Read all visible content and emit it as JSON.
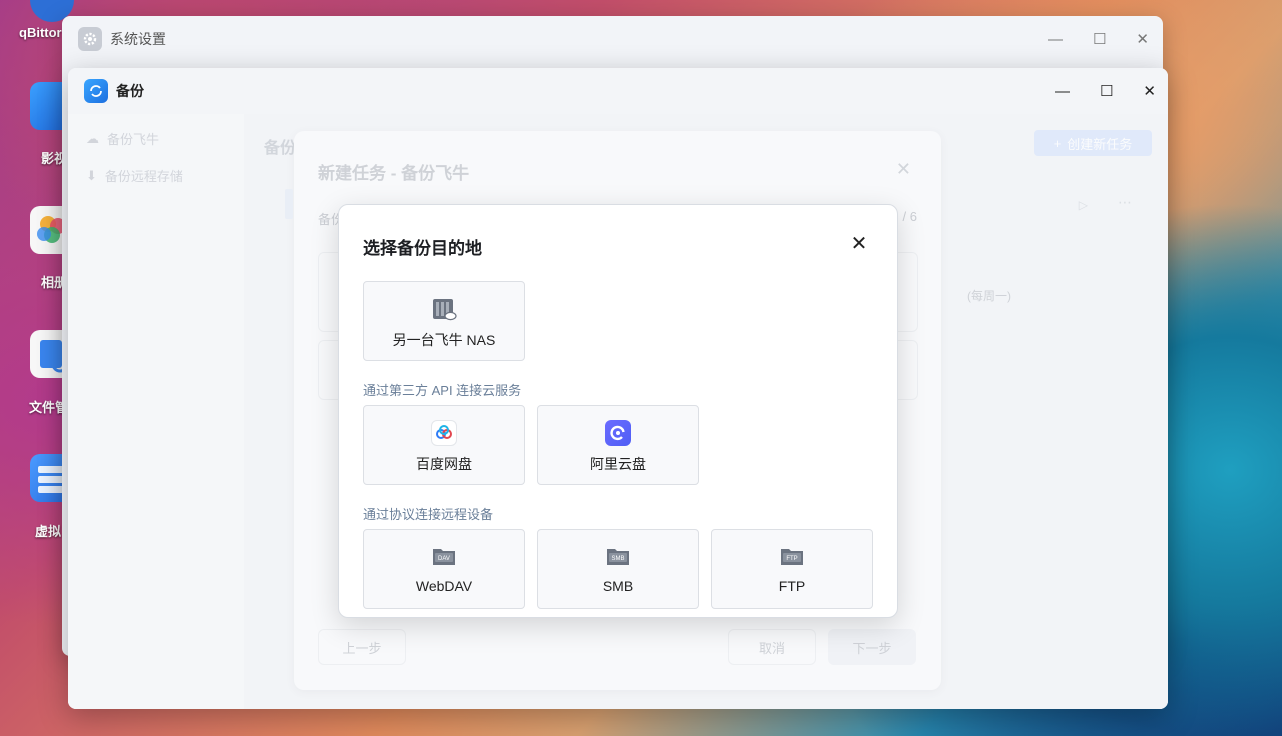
{
  "desktop": {
    "icons": [
      {
        "label": "qBittor",
        "color": "#2d6fd6"
      },
      {
        "label": "影视",
        "color": "#2b86f0"
      },
      {
        "label": "相册",
        "color": "#f5f5f5"
      },
      {
        "label": "文件管",
        "color": "#f5f5f5"
      },
      {
        "label": "虚拟",
        "color": "#2f7ee8"
      }
    ]
  },
  "back_window": {
    "title": "系统设置",
    "icon": "gear-icon"
  },
  "front_window": {
    "title": "备份",
    "icon": "backup-app-icon",
    "sidebar": [
      {
        "label": "备份飞牛",
        "icon": "cloud-icon"
      },
      {
        "label": "备份远程存储",
        "icon": "download-icon"
      }
    ],
    "main_title": "备份",
    "create_button": "创建新任务"
  },
  "task_dialog": {
    "title": "新建任务 - 备份飞牛",
    "step_label": "备份",
    "step_count": "/ 6",
    "schedule_hint": "(每周一)",
    "prev_button": "上一步",
    "cancel_button": "取消",
    "next_button": "下一步"
  },
  "destination_dialog": {
    "title": "选择备份目的地",
    "primary_option": {
      "label": "另一台飞牛 NAS",
      "icon": "nas-server-icon"
    },
    "cloud_section": {
      "label": "通过第三方 API 连接云服务",
      "options": [
        {
          "label": "百度网盘",
          "icon": "baidu-netdisk-icon"
        },
        {
          "label": "阿里云盘",
          "icon": "aliyun-drive-icon"
        }
      ]
    },
    "protocol_section": {
      "label": "通过协议连接远程设备",
      "options": [
        {
          "label": "WebDAV",
          "icon": "webdav-icon",
          "badge": "DAV"
        },
        {
          "label": "SMB",
          "icon": "smb-icon",
          "badge": "SMB"
        },
        {
          "label": "FTP",
          "icon": "ftp-icon",
          "badge": "FTP"
        }
      ]
    }
  }
}
